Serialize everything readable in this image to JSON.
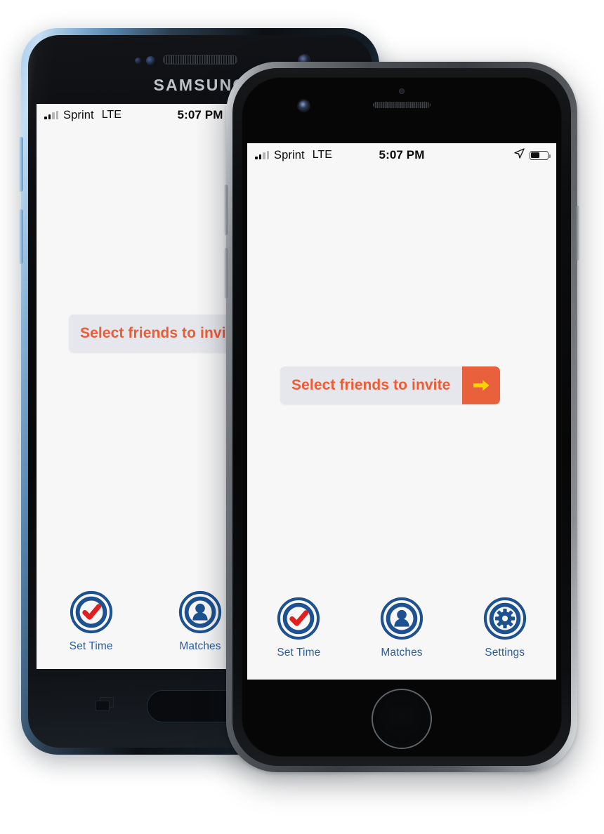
{
  "scene": {
    "description": "Two smartphone mockups side by side showing the same mobile app screen",
    "devices": [
      {
        "id": "samsung",
        "brand_wordmark": "SAMSUNG",
        "frame_color": "#8fb9dc",
        "bezel_color": "#0a0b0e"
      },
      {
        "id": "iphone",
        "brand_wordmark": "",
        "frame_color": "#8d9196",
        "bezel_color": "#070708"
      }
    ]
  },
  "status_bar": {
    "signal_icon": "signal-bars-icon",
    "carrier": "Sprint",
    "network": "LTE",
    "time": "5:07 PM",
    "location_icon": "location-arrow-icon",
    "battery_icon": "battery-icon",
    "battery_level": 48
  },
  "screen": {
    "background_color": "#f7f7f7",
    "invite_button": {
      "label": "Select friends to invite",
      "label_color": "#ef5b33",
      "background_color": "#e6e7ec",
      "arrow_block_color": "#e8603c",
      "arrow_icon": "arrow-right-icon",
      "arrow_color": "#f5d400"
    }
  },
  "tab_bar": {
    "accent_color": "#1d5190",
    "label_color": "#2c5e9e",
    "tabs": [
      {
        "id": "set-time",
        "label": "Set Time",
        "icon": "check-circle-icon",
        "icon_accent": "#e02020"
      },
      {
        "id": "matches",
        "label": "Matches",
        "icon": "person-circle-icon",
        "icon_accent": "#1d5190"
      },
      {
        "id": "settings",
        "label": "Settings",
        "icon": "gear-circle-icon",
        "icon_accent": "#1d5190"
      }
    ]
  },
  "hardware": {
    "samsung_recents_icon": "recents-icon",
    "samsung_home_button": "home-button",
    "iphone_home_button": "home-button",
    "iphone_camera": "front-camera-icon",
    "iphone_speaker": "earpiece-speaker",
    "samsung_camera": "front-camera-icon",
    "samsung_speaker": "earpiece-speaker"
  }
}
